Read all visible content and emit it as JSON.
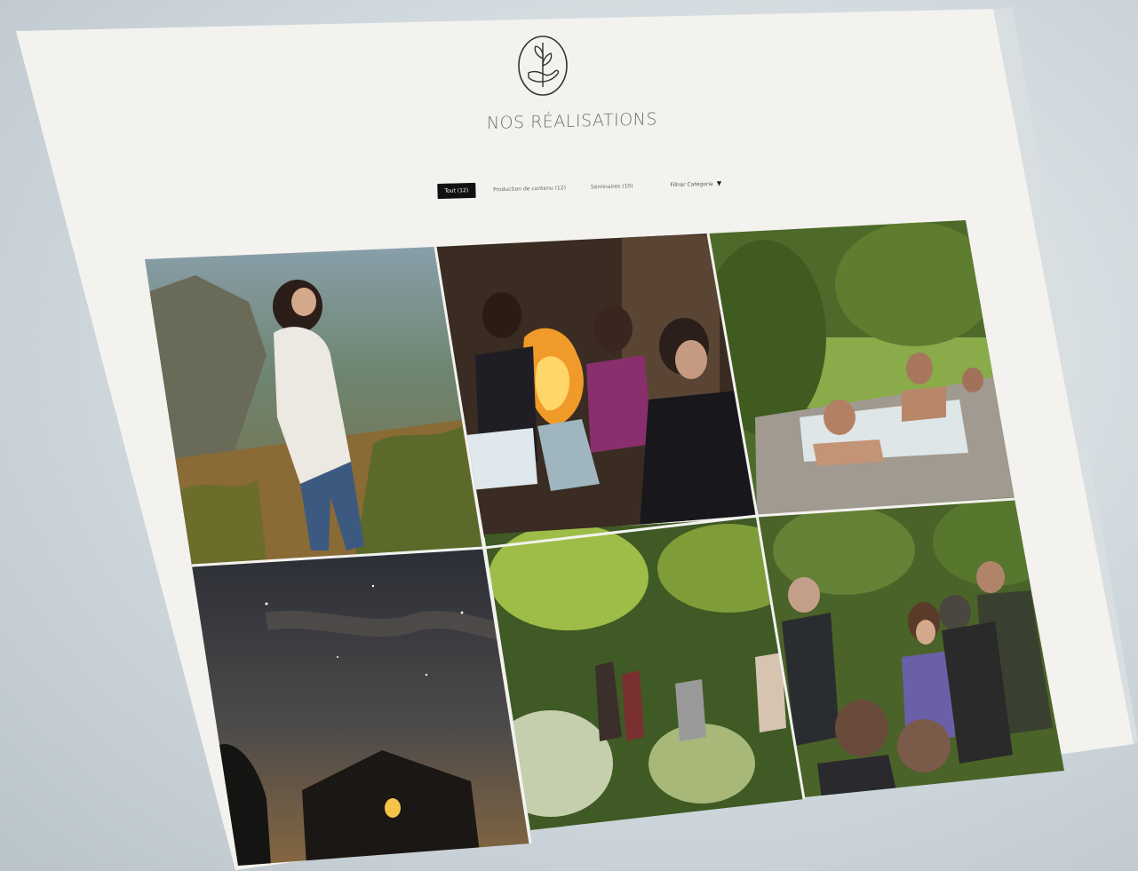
{
  "page": {
    "title": "NOS RÉALISATIONS"
  },
  "logo": {
    "icon": "hand-holding-sprout-icon"
  },
  "filters": {
    "items": [
      {
        "label": "Tout (12)",
        "active": true
      },
      {
        "label": "Production de contenu (12)",
        "active": false
      },
      {
        "label": "Séminaires (10)",
        "active": false
      }
    ],
    "dropdown": {
      "label": "Filtrer Catégorie",
      "icon": "chevron-down-icon"
    }
  },
  "gallery": {
    "tiles": [
      {
        "subject": "woman-on-mountain-photo"
      },
      {
        "subject": "meeting-by-fireplace-photo"
      },
      {
        "subject": "outdoor-stone-hot-tub-photo"
      },
      {
        "subject": "night-sky-stone-house-photo"
      },
      {
        "subject": "forest-hiking-group-photo"
      },
      {
        "subject": "group-in-woods-photo"
      }
    ]
  },
  "colors": {
    "page_bg": "#f3f2ef",
    "active_filter_bg": "#111111",
    "title_text": "#6f6f6f"
  }
}
